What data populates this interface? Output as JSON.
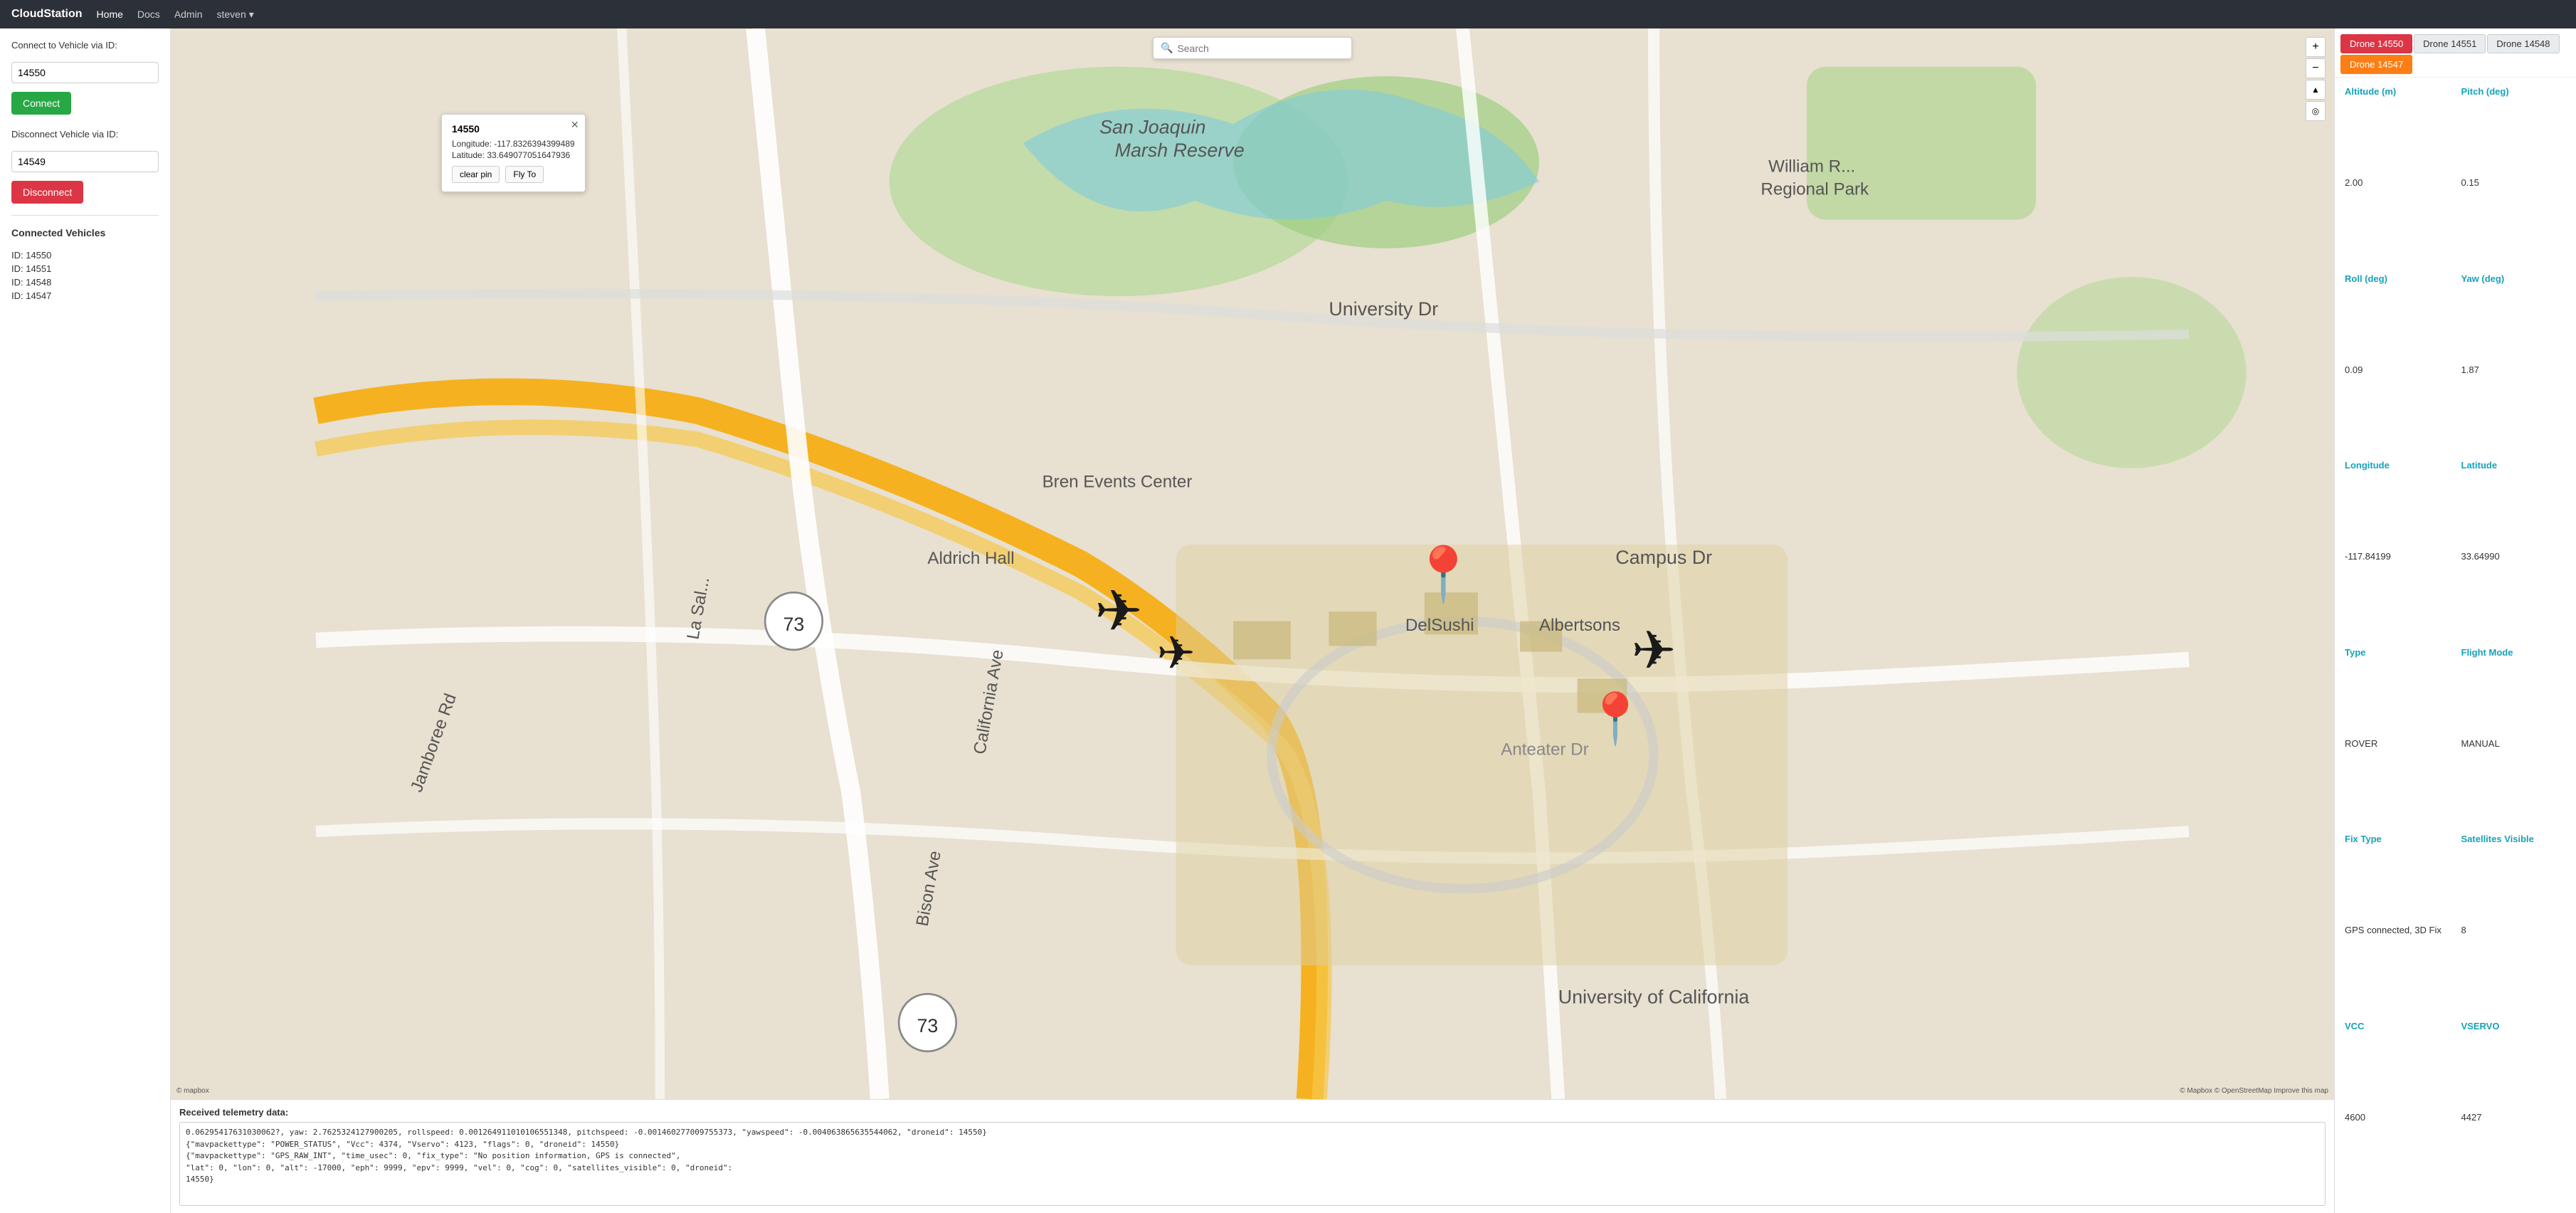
{
  "app": {
    "brand": "CloudStation",
    "nav": {
      "home": "Home",
      "docs": "Docs",
      "admin": "Admin",
      "user": "steven"
    }
  },
  "sidebar": {
    "connect_label": "Connect to Vehicle via ID:",
    "connect_value": "14550",
    "connect_btn": "Connect",
    "disconnect_label": "Disconnect Vehicle via ID:",
    "disconnect_value": "14549",
    "disconnect_btn": "Disconnect",
    "connected_vehicles_title": "Connected Vehicles",
    "vehicles": [
      {
        "label": "ID: 14550"
      },
      {
        "label": "ID: 14551"
      },
      {
        "label": "ID: 14548"
      },
      {
        "label": "ID: 14547"
      }
    ]
  },
  "map": {
    "search_placeholder": "Search",
    "attribution": "© Mapbox © OpenStreetMap Improve this map",
    "mapbox_logo": "© mapbox",
    "popup": {
      "title": "14550",
      "longitude_label": "Longitude: -117.8326394399489",
      "latitude_label": "Latitude: 33.649077051647936",
      "clear_pin_btn": "clear pin",
      "fly_to_btn": "Fly To"
    }
  },
  "drone_tabs": [
    {
      "id": "14550",
      "label": "Drone 14550",
      "style": "active-red"
    },
    {
      "id": "14551",
      "label": "Drone 14551",
      "style": "inactive"
    },
    {
      "id": "14548",
      "label": "Drone 14548",
      "style": "inactive"
    },
    {
      "id": "14547",
      "label": "Drone 14547",
      "style": "active-orange"
    }
  ],
  "telemetry": {
    "altitude_header": "Altitude (m)",
    "altitude_value": "2.00",
    "pitch_header": "Pitch (deg)",
    "pitch_value": "0.15",
    "roll_header": "Roll (deg)",
    "roll_value": "0.09",
    "yaw_header": "Yaw (deg)",
    "yaw_value": "1.87",
    "longitude_header": "Longitude",
    "longitude_value": "-117.84199",
    "latitude_header": "Latitude",
    "latitude_value": "33.64990",
    "type_header": "Type",
    "type_value": "ROVER",
    "flight_mode_header": "Flight Mode",
    "flight_mode_value": "MANUAL",
    "fix_type_header": "Fix Type",
    "fix_type_value": "GPS connected, 3D Fix",
    "satellites_header": "Satellites Visible",
    "satellites_value": "8",
    "vcc_header": "VCC",
    "vcc_value": "4600",
    "vservo_header": "VSERVO",
    "vservo_value": "4427"
  },
  "telemetry_log": {
    "label": "Received telemetry data:",
    "lines": [
      "0.06295417631030062?, yaw: 2.7625324127900205, rollspeed: 0.001264911010106551348, pitchspeed: -0.001460277009755373, \"yawspeed\": -0.004063865635544062, \"droneid\": 14550}",
      "{\"mavpackettype\": \"POWER_STATUS\", \"Vcc\": 4374, \"Vservo\": 4123, \"flags\": 0, \"droneid\": 14550}",
      "{\"mavpackettype\": \"GPS_RAW_INT\", \"time_usec\": 0, \"fix_type\": \"No position information, GPS is connected\",",
      "\"lat\": 0, \"lon\": 0, \"alt\": -17000, \"eph\": 9999, \"epv\": 9999, \"vel\": 0, \"cog\": 0, \"satellites_visible\": 0, \"droneid\":",
      "14550}"
    ]
  }
}
